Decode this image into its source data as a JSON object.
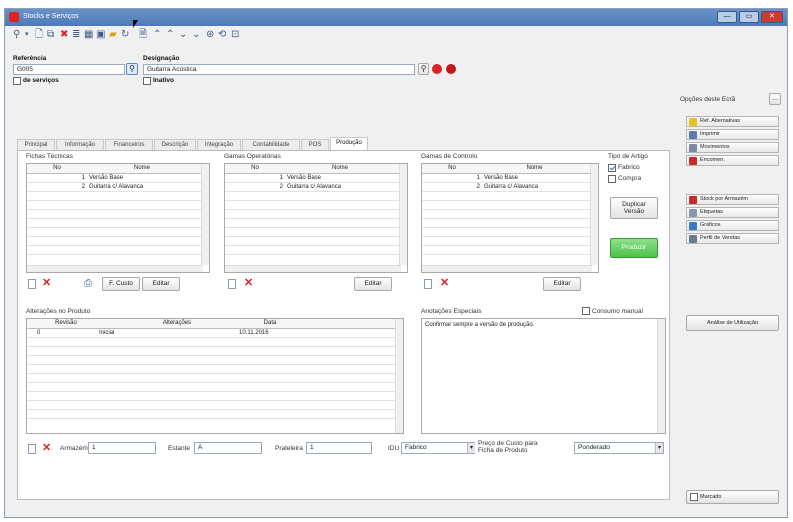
{
  "window": {
    "title": "Stocks e Serviços",
    "min_label": "—",
    "max_label": "▭",
    "close_label": "✕"
  },
  "toolbar": {
    "icons": [
      "search-icon",
      "chevron-down-icon",
      "new-document-icon",
      "copy-icon",
      "delete-icon",
      "list-icon",
      "grid-icon",
      "folder-icon",
      "refresh-icon",
      "document-icon",
      "arrow-up-icon",
      "arrow-up-icon",
      "arrow-down-icon",
      "arrow-down-icon",
      "globe-icon",
      "sync-icon",
      "zoom-icon"
    ]
  },
  "header": {
    "referencia_label": "Referência",
    "referencia_value": "G005",
    "designacao_label": "Designação",
    "designacao_value": "Guitarra Acústica",
    "de_servicos_label": "de serviços",
    "inativo_label": "Inativo",
    "opcoes_label": "Opções deste Ecrã"
  },
  "tabs": [
    {
      "label": "Principal",
      "active": false
    },
    {
      "label": "Informação",
      "active": false
    },
    {
      "label": "Financeiros",
      "active": false
    },
    {
      "label": "Descrição",
      "active": false
    },
    {
      "label": "Integração",
      "active": false
    },
    {
      "label": "Contabilidade",
      "active": false
    },
    {
      "label": "POS",
      "active": false
    },
    {
      "label": "Produção",
      "active": true
    }
  ],
  "fichas": {
    "title": "Fichas Técnicas",
    "col_no": "No",
    "col_nome": "Nome",
    "rows": [
      {
        "no": "1",
        "nome": "Versão Base"
      },
      {
        "no": "2",
        "nome": "Guitarra c/ Alavanca"
      }
    ],
    "fcusto_label": "F. Custo",
    "editar_label": "Editar"
  },
  "gamas_op": {
    "title": "Gamas Operatórias",
    "col_no": "No",
    "col_nome": "Nome",
    "rows": [
      {
        "no": "1",
        "nome": "Versão Base"
      },
      {
        "no": "2",
        "nome": "Guitarra c/ Alavanca"
      }
    ],
    "editar_label": "Editar"
  },
  "gamas_ctrl": {
    "title": "Gamas de Controlo",
    "col_no": "No",
    "col_nome": "Nome",
    "rows": [
      {
        "no": "1",
        "nome": "Versão Base"
      },
      {
        "no": "2",
        "nome": "Guitarra c/ Alavanca"
      }
    ],
    "editar_label": "Editar"
  },
  "tipo_artigo": {
    "title": "Tipo de Artigo",
    "fabrico_label": "Fabrico",
    "fabrico_checked": true,
    "compra_label": "Compra",
    "compra_checked": false,
    "duplicar_label_1": "Duplicar",
    "duplicar_label_2": "Versão",
    "produzir_label": "Produzir"
  },
  "alteracoes": {
    "title": "Alterações no Produto",
    "col_revisao": "Revisão",
    "col_alteracoes": "Alterações",
    "col_data": "Data",
    "rows": [
      {
        "revisao": "0",
        "alteracoes": "Inicial",
        "data": "10.11.2016"
      }
    ]
  },
  "anotacoes": {
    "title": "Anotações Especiais",
    "consumo_manual_label": "Consumo manual",
    "text": "Confirmar sempre a versão de produção."
  },
  "bottom": {
    "armazem_label": "Armazém",
    "armazem_value": "1",
    "estante_label": "Estante",
    "estante_value": "A",
    "prateleira_label": "Prateleira",
    "prateleira_value": "1",
    "idu_label": "IDU",
    "idu_value": "Fabrico",
    "preco_label_1": "Preço de Custo para",
    "preco_label_2": "Ficha de Produto",
    "preco_value": "Ponderado"
  },
  "sidebar": {
    "items": [
      {
        "label": "Ref. Alternativas",
        "icon": "pencil-icon",
        "color": "#e8c020"
      },
      {
        "label": "Imprimir",
        "icon": "printer-icon",
        "color": "#5a7ab0"
      },
      {
        "label": "Movimentos",
        "icon": "movements-icon",
        "color": "#7a8aa0"
      },
      {
        "label": "Encomen.",
        "icon": "cart-icon",
        "color": "#c82a2a"
      },
      {
        "label": "Stock por Armazém",
        "icon": "warehouse-icon",
        "color": "#c82a2a"
      },
      {
        "label": "Etiquetas",
        "icon": "label-icon",
        "color": "#8898b0"
      },
      {
        "label": "Gráficos",
        "icon": "chart-icon",
        "color": "#3c7ac8"
      },
      {
        "label": "Perfil de Vendas",
        "icon": "profile-icon",
        "color": "#6a7a90"
      }
    ],
    "analise_label": "Análise de Utilização",
    "marcado_label": "Marcado"
  }
}
